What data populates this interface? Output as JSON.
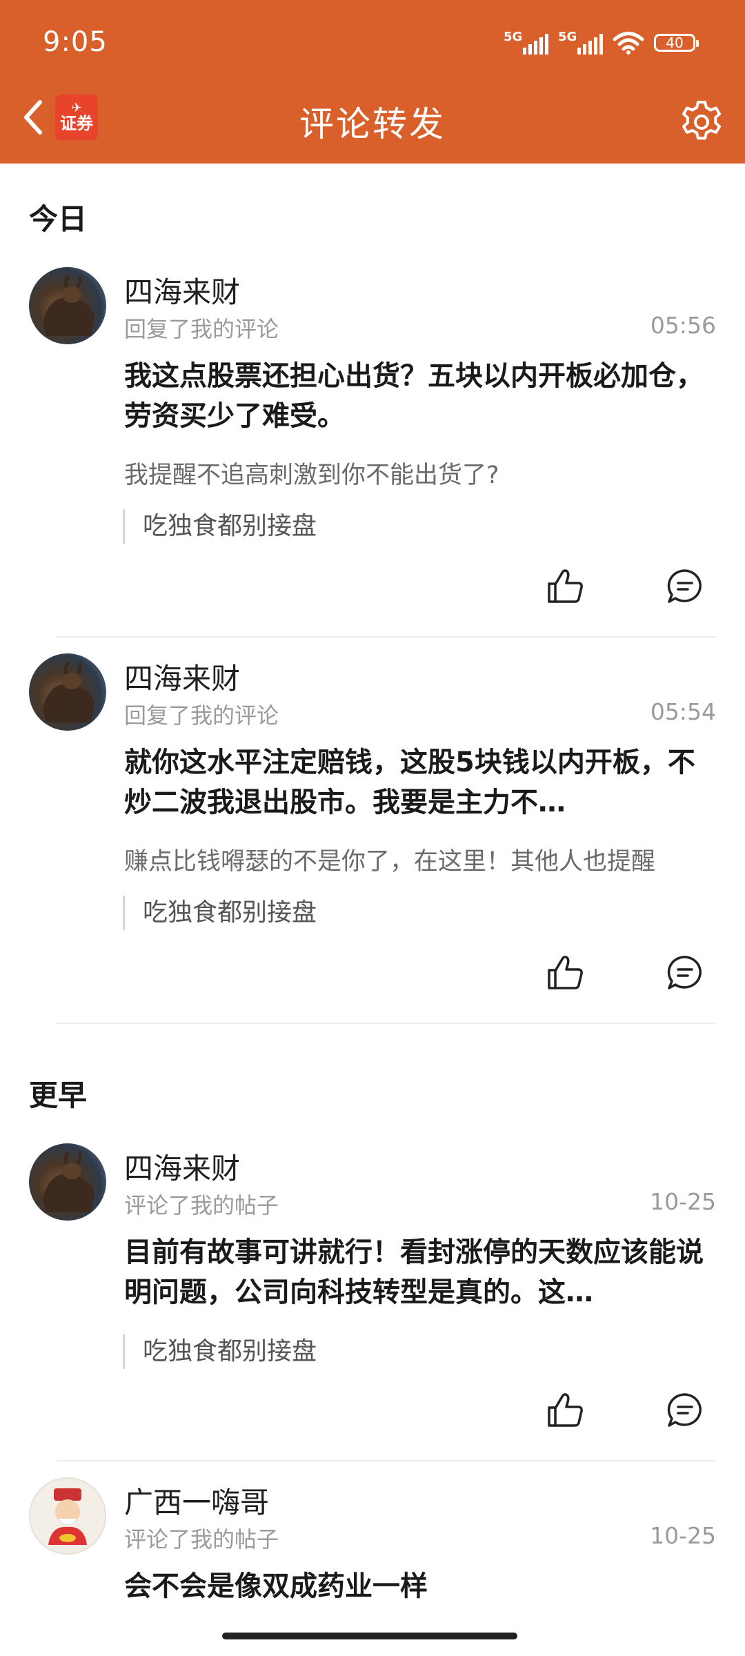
{
  "status_bar": {
    "time": "9:05",
    "net1": "5G",
    "net2": "5G",
    "battery": "40"
  },
  "header": {
    "title": "评论转发",
    "logo_text": "证券"
  },
  "sections": [
    {
      "title": "今日"
    },
    {
      "title": "更早"
    }
  ],
  "items": [
    {
      "user": "四海来财",
      "action": "回复了我的评论",
      "time": "05:56",
      "content": "我这点股票还担心出货？五块以内开板必加仓，劳资买少了难受。",
      "sub": "我提醒不追高刺激到你不能出货了?",
      "quote": "吃独食都别接盘"
    },
    {
      "user": "四海来财",
      "action": "回复了我的评论",
      "time": "05:54",
      "content": "就你这水平注定赔钱，这股5块钱以内开板，不炒二波我退出股市。我要是主力不…",
      "sub": "赚点比钱嘚瑟的不是你了，在这里！其他人也提醒",
      "quote": "吃独食都别接盘"
    },
    {
      "user": "四海来财",
      "action": "评论了我的帖子",
      "time": "10-25",
      "content": "目前有故事可讲就行！看封涨停的天数应该能说明问题，公司向科技转型是真的。这…",
      "quote": "吃独食都别接盘"
    },
    {
      "user": "广西一嗨哥",
      "action": "评论了我的帖子",
      "time": "10-25",
      "content": "会不会是像双成药业一样"
    }
  ]
}
